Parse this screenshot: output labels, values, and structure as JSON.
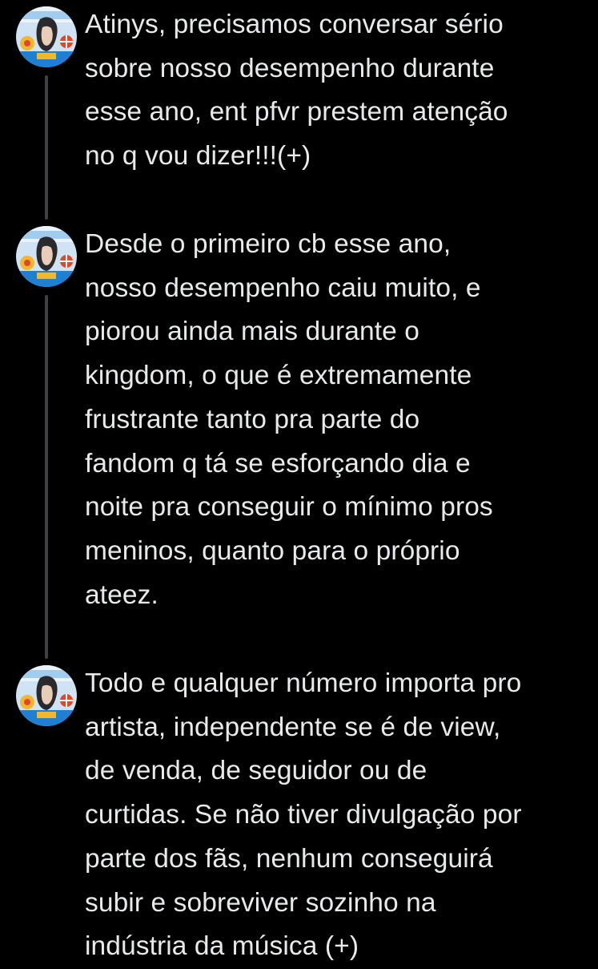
{
  "thread": {
    "tweets": [
      {
        "avatar_icon": "user-avatar-icon",
        "text": "Atinys, precisamos conversar sério\nsobre nosso desempenho durante\nesse ano, ent pfvr prestem atenção\nno q vou dizer!!!(+)"
      },
      {
        "avatar_icon": "user-avatar-icon",
        "text": "Desde o primeiro cb esse ano,\nnosso desempenho caiu muito, e\npiorou ainda mais durante o\nkingdom, o que é extremamente\nfrustrante tanto pra parte do\nfandom q tá se esforçando dia e\nnoite pra conseguir o mínimo pros\nmeninos, quanto para o próprio\nateez."
      },
      {
        "avatar_icon": "user-avatar-icon",
        "text": "Todo e qualquer número importa pro\nartista, independente se é de view,\nde venda, de seguidor ou de\ncurtidas. Se não tiver divulgação por\nparte dos fãs, nenhum conseguirá\nsubir e sobreviver sozinho na\nindústria da música (+)"
      }
    ]
  },
  "colors": {
    "background": "#000000",
    "text": "#e7e9ea",
    "thread_line": "#3e4144"
  }
}
